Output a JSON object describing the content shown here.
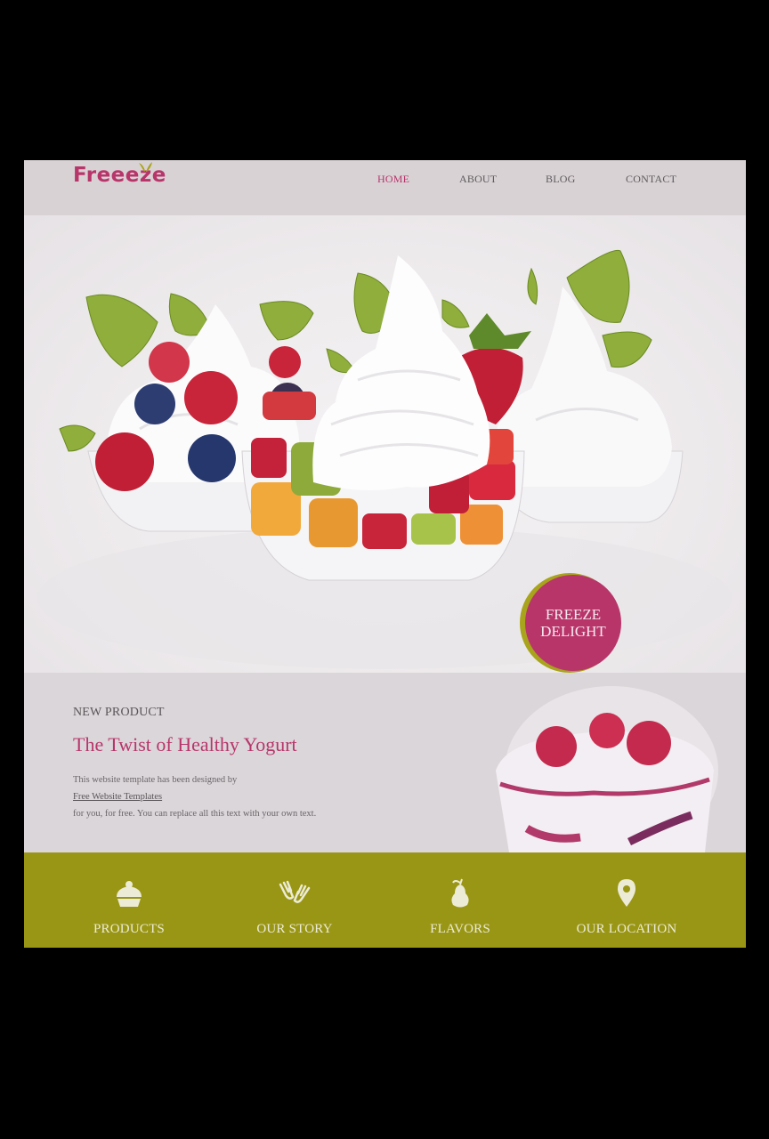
{
  "header": {
    "logo": "Freeeze",
    "nav": [
      {
        "label": "HOME",
        "active": true
      },
      {
        "label": "ABOUT",
        "active": false
      },
      {
        "label": "BLOG",
        "active": false
      },
      {
        "label": "CONTACT",
        "active": false
      }
    ]
  },
  "hero": {
    "badge_line1": "FREEZE",
    "badge_line2": "DELIGHT"
  },
  "product": {
    "label": "NEW PRODUCT",
    "title": "The Twist of Healthy Yogurt",
    "text_line1": "This website template has been designed by",
    "link": "Free Website Templates",
    "text_line2": "for you, for free. You can replace all this text with your own text."
  },
  "band": {
    "items": [
      {
        "label": "PRODUCTS",
        "icon": "cupcake-icon"
      },
      {
        "label": "OUR STORY",
        "icon": "hands-icon"
      },
      {
        "label": "FLAVORS",
        "icon": "pear-icon"
      },
      {
        "label": "OUR LOCATION",
        "icon": "location-pin-icon"
      }
    ]
  },
  "colors": {
    "accent": "#b8356a",
    "band": "#9a9615",
    "header": "#d8d2d5",
    "badge_ring": "#a8a41c"
  }
}
